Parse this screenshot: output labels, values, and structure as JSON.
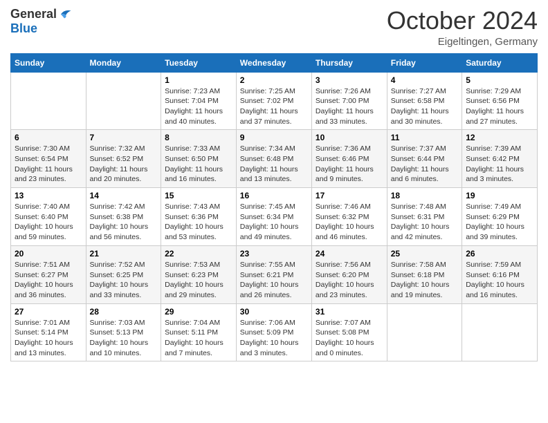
{
  "header": {
    "logo": {
      "general": "General",
      "blue": "Blue"
    },
    "month": "October 2024",
    "location": "Eigeltingen, Germany"
  },
  "weekdays": [
    "Sunday",
    "Monday",
    "Tuesday",
    "Wednesday",
    "Thursday",
    "Friday",
    "Saturday"
  ],
  "weeks": [
    [
      {
        "day": "",
        "info": ""
      },
      {
        "day": "",
        "info": ""
      },
      {
        "day": "1",
        "info": "Sunrise: 7:23 AM\nSunset: 7:04 PM\nDaylight: 11 hours and 40 minutes."
      },
      {
        "day": "2",
        "info": "Sunrise: 7:25 AM\nSunset: 7:02 PM\nDaylight: 11 hours and 37 minutes."
      },
      {
        "day": "3",
        "info": "Sunrise: 7:26 AM\nSunset: 7:00 PM\nDaylight: 11 hours and 33 minutes."
      },
      {
        "day": "4",
        "info": "Sunrise: 7:27 AM\nSunset: 6:58 PM\nDaylight: 11 hours and 30 minutes."
      },
      {
        "day": "5",
        "info": "Sunrise: 7:29 AM\nSunset: 6:56 PM\nDaylight: 11 hours and 27 minutes."
      }
    ],
    [
      {
        "day": "6",
        "info": "Sunrise: 7:30 AM\nSunset: 6:54 PM\nDaylight: 11 hours and 23 minutes."
      },
      {
        "day": "7",
        "info": "Sunrise: 7:32 AM\nSunset: 6:52 PM\nDaylight: 11 hours and 20 minutes."
      },
      {
        "day": "8",
        "info": "Sunrise: 7:33 AM\nSunset: 6:50 PM\nDaylight: 11 hours and 16 minutes."
      },
      {
        "day": "9",
        "info": "Sunrise: 7:34 AM\nSunset: 6:48 PM\nDaylight: 11 hours and 13 minutes."
      },
      {
        "day": "10",
        "info": "Sunrise: 7:36 AM\nSunset: 6:46 PM\nDaylight: 11 hours and 9 minutes."
      },
      {
        "day": "11",
        "info": "Sunrise: 7:37 AM\nSunset: 6:44 PM\nDaylight: 11 hours and 6 minutes."
      },
      {
        "day": "12",
        "info": "Sunrise: 7:39 AM\nSunset: 6:42 PM\nDaylight: 11 hours and 3 minutes."
      }
    ],
    [
      {
        "day": "13",
        "info": "Sunrise: 7:40 AM\nSunset: 6:40 PM\nDaylight: 10 hours and 59 minutes."
      },
      {
        "day": "14",
        "info": "Sunrise: 7:42 AM\nSunset: 6:38 PM\nDaylight: 10 hours and 56 minutes."
      },
      {
        "day": "15",
        "info": "Sunrise: 7:43 AM\nSunset: 6:36 PM\nDaylight: 10 hours and 53 minutes."
      },
      {
        "day": "16",
        "info": "Sunrise: 7:45 AM\nSunset: 6:34 PM\nDaylight: 10 hours and 49 minutes."
      },
      {
        "day": "17",
        "info": "Sunrise: 7:46 AM\nSunset: 6:32 PM\nDaylight: 10 hours and 46 minutes."
      },
      {
        "day": "18",
        "info": "Sunrise: 7:48 AM\nSunset: 6:31 PM\nDaylight: 10 hours and 42 minutes."
      },
      {
        "day": "19",
        "info": "Sunrise: 7:49 AM\nSunset: 6:29 PM\nDaylight: 10 hours and 39 minutes."
      }
    ],
    [
      {
        "day": "20",
        "info": "Sunrise: 7:51 AM\nSunset: 6:27 PM\nDaylight: 10 hours and 36 minutes."
      },
      {
        "day": "21",
        "info": "Sunrise: 7:52 AM\nSunset: 6:25 PM\nDaylight: 10 hours and 33 minutes."
      },
      {
        "day": "22",
        "info": "Sunrise: 7:53 AM\nSunset: 6:23 PM\nDaylight: 10 hours and 29 minutes."
      },
      {
        "day": "23",
        "info": "Sunrise: 7:55 AM\nSunset: 6:21 PM\nDaylight: 10 hours and 26 minutes."
      },
      {
        "day": "24",
        "info": "Sunrise: 7:56 AM\nSunset: 6:20 PM\nDaylight: 10 hours and 23 minutes."
      },
      {
        "day": "25",
        "info": "Sunrise: 7:58 AM\nSunset: 6:18 PM\nDaylight: 10 hours and 19 minutes."
      },
      {
        "day": "26",
        "info": "Sunrise: 7:59 AM\nSunset: 6:16 PM\nDaylight: 10 hours and 16 minutes."
      }
    ],
    [
      {
        "day": "27",
        "info": "Sunrise: 7:01 AM\nSunset: 5:14 PM\nDaylight: 10 hours and 13 minutes."
      },
      {
        "day": "28",
        "info": "Sunrise: 7:03 AM\nSunset: 5:13 PM\nDaylight: 10 hours and 10 minutes."
      },
      {
        "day": "29",
        "info": "Sunrise: 7:04 AM\nSunset: 5:11 PM\nDaylight: 10 hours and 7 minutes."
      },
      {
        "day": "30",
        "info": "Sunrise: 7:06 AM\nSunset: 5:09 PM\nDaylight: 10 hours and 3 minutes."
      },
      {
        "day": "31",
        "info": "Sunrise: 7:07 AM\nSunset: 5:08 PM\nDaylight: 10 hours and 0 minutes."
      },
      {
        "day": "",
        "info": ""
      },
      {
        "day": "",
        "info": ""
      }
    ]
  ]
}
